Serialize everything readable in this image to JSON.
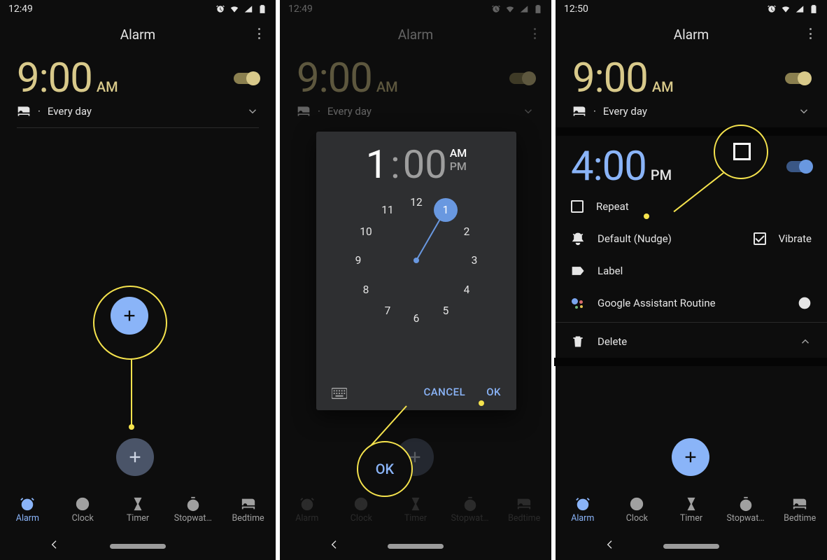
{
  "colors": {
    "gold": "#d8c98a",
    "blue": "#8ab4f8"
  },
  "p1": {
    "status_time": "12:49",
    "title": "Alarm",
    "alarm": {
      "time": "9:00",
      "mer": "AM",
      "sub": "Every day",
      "enabled": true
    },
    "fab_icon": "plus",
    "nav": {
      "items": [
        "Alarm",
        "Clock",
        "Timer",
        "Stopwat…",
        "Bedtime"
      ],
      "selected": 0
    }
  },
  "p2": {
    "status_time": "12:49",
    "title": "Alarm",
    "alarm": {
      "time": "9:00",
      "mer": "AM",
      "sub": "Every day",
      "enabled": true
    },
    "dialog": {
      "hour": "1",
      "minute": "00",
      "mer_selected": "AM",
      "mer": [
        "AM",
        "PM"
      ],
      "clock_numbers": [
        "12",
        "1",
        "2",
        "3",
        "4",
        "5",
        "6",
        "7",
        "8",
        "9",
        "10",
        "11"
      ],
      "selected": "1",
      "cancel": "CANCEL",
      "ok": "OK"
    },
    "nav": {
      "items": [
        "Alarm",
        "Clock",
        "Timer",
        "Stopwat…",
        "Bedtime"
      ],
      "selected": 0
    },
    "callout_label": "OK"
  },
  "p3": {
    "status_time": "12:50",
    "title": "Alarm",
    "alarm1": {
      "time": "9:00",
      "mer": "AM",
      "sub": "Every day",
      "enabled": true
    },
    "alarm2": {
      "time": "4:00",
      "mer": "PM",
      "enabled": true,
      "repeat": "Repeat",
      "sound": "Default (Nudge)",
      "vibrate": "Vibrate",
      "label": "Label",
      "routine": "Google Assistant Routine",
      "delete": "Delete"
    },
    "nav": {
      "items": [
        "Alarm",
        "Clock",
        "Timer",
        "Stopwat…",
        "Bedtime"
      ],
      "selected": 0
    }
  }
}
